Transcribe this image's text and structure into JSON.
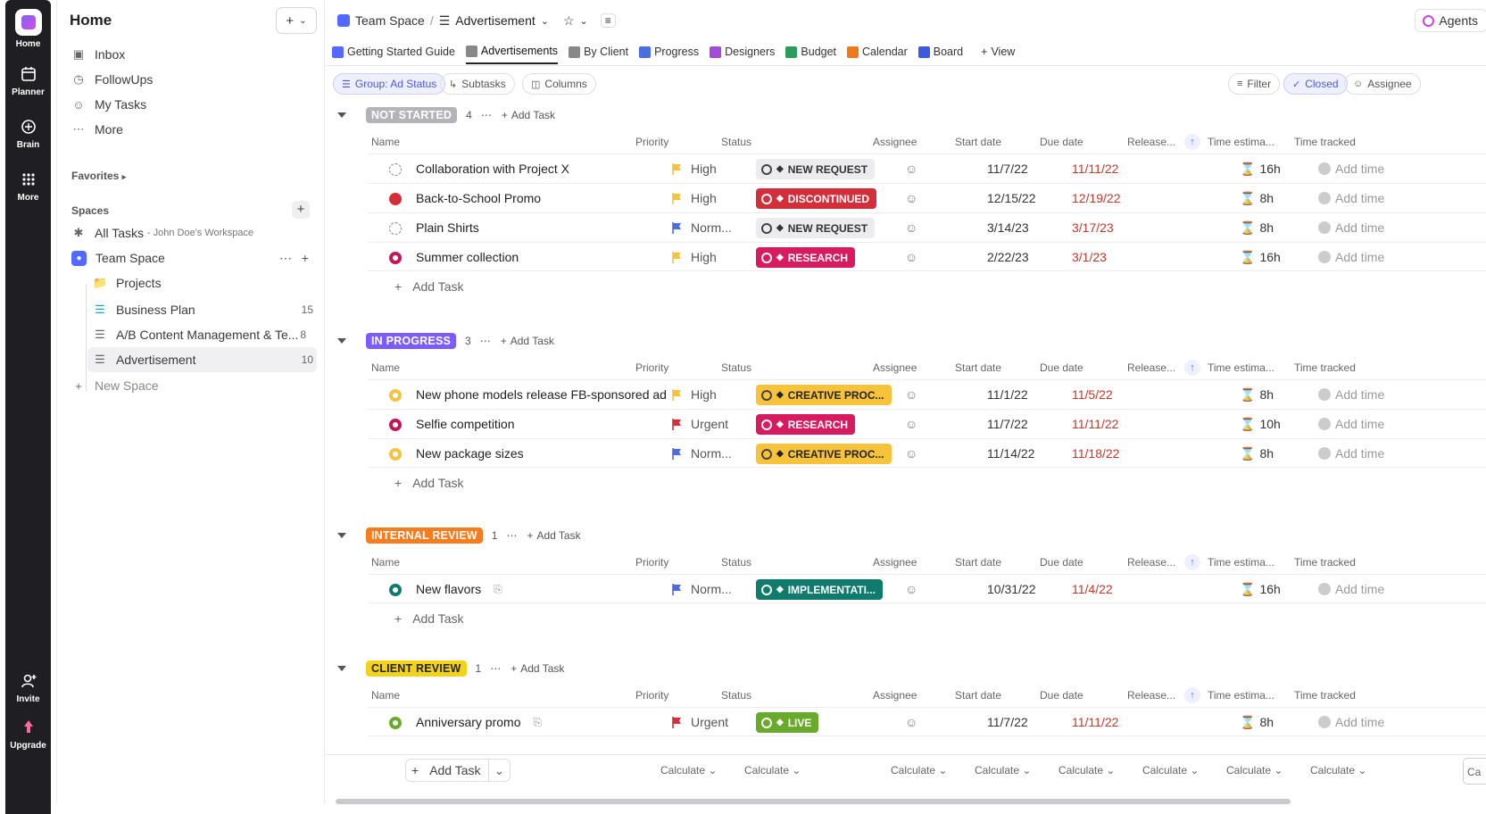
{
  "rail": {
    "items": [
      {
        "label": "Home",
        "icon": "home-logo-icon"
      },
      {
        "label": "Planner",
        "icon": "calendar-icon"
      },
      {
        "label": "Brain",
        "icon": "brain-icon"
      },
      {
        "label": "More",
        "icon": "grid-icon"
      },
      {
        "label": "Invite",
        "icon": "add-user-icon"
      },
      {
        "label": "Upgrade",
        "icon": "rocket-icon"
      }
    ]
  },
  "sidebar": {
    "title": "Home",
    "nav": [
      {
        "label": "Inbox",
        "icon": "inbox-icon"
      },
      {
        "label": "FollowUps",
        "icon": "followups-icon"
      },
      {
        "label": "My Tasks",
        "icon": "user-icon"
      },
      {
        "label": "More",
        "icon": "dots-icon"
      }
    ],
    "favorites_label": "Favorites",
    "spaces_label": "Spaces",
    "all_tasks": {
      "label": "All Tasks",
      "workspace": "- John Doe's Workspace"
    },
    "team_space": "Team Space",
    "items": [
      {
        "label": "Projects",
        "count": ""
      },
      {
        "label": "Business Plan",
        "count": "15"
      },
      {
        "label": "A/B Content Management & Te...",
        "count": "8"
      },
      {
        "label": "Advertisement",
        "count": "10"
      }
    ],
    "new_space": "New Space"
  },
  "header": {
    "space": "Team Space",
    "separator": "/",
    "list": "Advertisement",
    "agents": "Agents",
    "views": [
      "Getting Started Guide",
      "Advertisements",
      "By Client",
      "Progress",
      "Designers",
      "Budget",
      "Calendar",
      "Board",
      "View"
    ],
    "active_view": "Advertisements"
  },
  "toolbar": {
    "group": "Group: Ad Status",
    "subtasks": "Subtasks",
    "columns": "Columns",
    "filter": "Filter",
    "closed": "Closed",
    "assignee": "Assignee"
  },
  "columns": [
    "Name",
    "Priority",
    "Status",
    "Assignee",
    "Start date",
    "Due date",
    "Release...",
    "Time estima...",
    "Time tracked"
  ],
  "add_task_label": "Add Task",
  "add_time_label": "Add time",
  "groups": [
    {
      "name": "NOT STARTED",
      "count": "4",
      "color": "#b3b3b8",
      "tasks": [
        {
          "name": "Collaboration with Project X",
          "circle": "dashed",
          "priority": "High",
          "flag": "#f5c242",
          "status": "NEW REQUEST",
          "status_color": "#ececee",
          "status_text": "#333",
          "start": "11/7/22",
          "due": "11/11/22",
          "estimate": "16h"
        },
        {
          "name": "Back-to-School Promo",
          "circle": "red",
          "priority": "High",
          "flag": "#f5c242",
          "status": "DISCONTINUED",
          "status_color": "#d32f3a",
          "status_text": "#fff",
          "start": "12/15/22",
          "due": "12/19/22",
          "estimate": "8h"
        },
        {
          "name": "Plain Shirts",
          "circle": "dashed",
          "priority": "Norm...",
          "flag": "#4a6ee0",
          "status": "NEW REQUEST",
          "status_color": "#ececee",
          "status_text": "#333",
          "start": "3/14/23",
          "due": "3/17/23",
          "estimate": "8h"
        },
        {
          "name": "Summer collection",
          "circle": "magenta",
          "priority": "High",
          "flag": "#f5c242",
          "status": "RESEARCH",
          "status_color": "#d81b60",
          "status_text": "#fff",
          "start": "2/22/23",
          "due": "3/1/23",
          "estimate": "16h"
        }
      ]
    },
    {
      "name": "IN PROGRESS",
      "count": "3",
      "color": "#7c5cff",
      "tasks": [
        {
          "name": "New phone models release FB-sponsored ad",
          "circle": "yellow",
          "priority": "High",
          "flag": "#f5c242",
          "status": "CREATIVE PROC...",
          "status_color": "#f7c33b",
          "status_text": "#222",
          "start": "11/1/22",
          "due": "11/5/22",
          "estimate": "8h"
        },
        {
          "name": "Selfie competition",
          "circle": "magenta",
          "priority": "Urgent",
          "flag": "#d32f3a",
          "status": "RESEARCH",
          "status_color": "#d81b60",
          "status_text": "#fff",
          "start": "11/7/22",
          "due": "11/11/22",
          "estimate": "10h"
        },
        {
          "name": "New package sizes",
          "circle": "yellow",
          "priority": "Norm...",
          "flag": "#4a6ee0",
          "status": "CREATIVE PROC...",
          "status_color": "#f7c33b",
          "status_text": "#222",
          "start": "11/14/22",
          "due": "11/18/22",
          "estimate": "8h"
        }
      ]
    },
    {
      "name": "INTERNAL REVIEW",
      "count": "1",
      "color": "#f57c1f",
      "tasks": [
        {
          "name": "New flavors",
          "circle": "teal",
          "priority": "Norm...",
          "flag": "#4a6ee0",
          "status": "IMPLEMENTATI...",
          "status_color": "#0f7b6c",
          "status_text": "#fff",
          "start": "10/31/22",
          "due": "11/4/22",
          "estimate": "16h"
        }
      ]
    },
    {
      "name": "CLIENT REVIEW",
      "count": "1",
      "color": "#f2d21b",
      "tasks": [
        {
          "name": "Anniversary promo",
          "circle": "green",
          "priority": "Urgent",
          "flag": "#d32f3a",
          "status": "LIVE",
          "status_color": "#6aaa2a",
          "status_text": "#fff",
          "start": "11/7/22",
          "due": "11/11/22",
          "estimate": "8h"
        }
      ]
    }
  ],
  "footer": {
    "add_task": "Add Task",
    "calculate": "Calculate",
    "last_cell": "Ca"
  }
}
